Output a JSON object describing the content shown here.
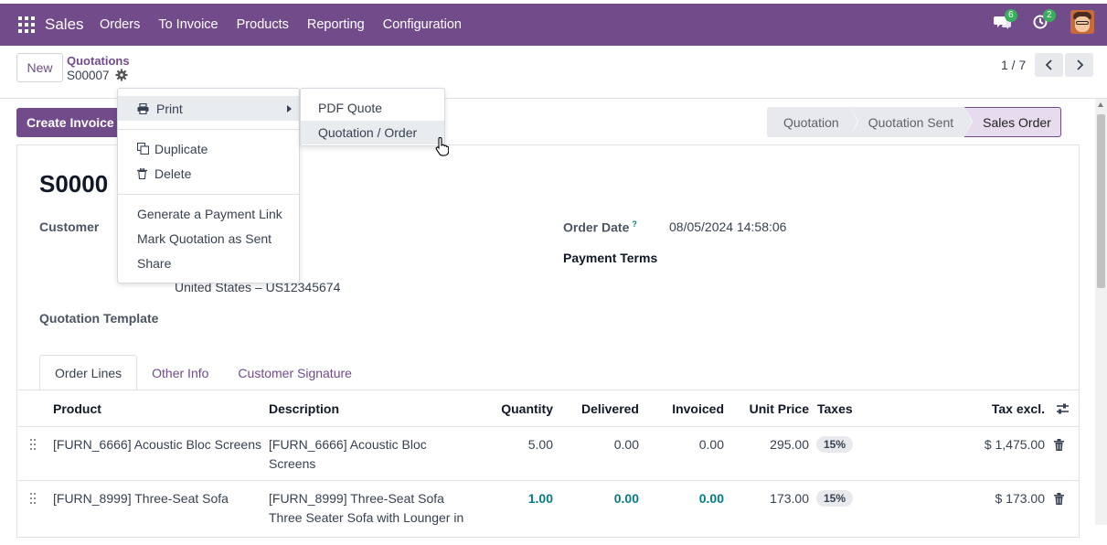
{
  "navbar": {
    "app_name": "Sales",
    "menu": [
      "Orders",
      "To Invoice",
      "Products",
      "Reporting",
      "Configuration"
    ],
    "messages_count": "6",
    "activities_count": "2",
    "brand_color": "#714b8a"
  },
  "control_panel": {
    "new_label": "New",
    "breadcrumb_parent": "Quotations",
    "breadcrumb_current": "S00007",
    "pager_value": "1 / 7"
  },
  "actions": {
    "create_invoice_label": "Create Invoice"
  },
  "statusbar": {
    "stages": [
      "Quotation",
      "Quotation Sent",
      "Sales Order"
    ],
    "current_stage": "Sales Order"
  },
  "form": {
    "order_name": "S0000",
    "customer_label": "Customer",
    "customer_address_line": "United States – US12345674",
    "quotation_template_label": "Quotation Template",
    "order_date_label": "Order Date",
    "order_date_help": "?",
    "order_date_value": "08/05/2024 14:58:06",
    "payment_terms_label": "Payment Terms"
  },
  "tabs": [
    "Order Lines",
    "Other Info",
    "Customer Signature"
  ],
  "table": {
    "headers": {
      "product": "Product",
      "description": "Description",
      "quantity": "Quantity",
      "delivered": "Delivered",
      "invoiced": "Invoiced",
      "unit_price": "Unit Price",
      "taxes": "Taxes",
      "tax_excl": "Tax excl."
    },
    "rows": [
      {
        "product": "[FURN_6666] Acoustic Bloc Screens",
        "description_1": "[FURN_6666] Acoustic Bloc",
        "description_2": "Screens",
        "quantity": "5.00",
        "delivered": "0.00",
        "invoiced": "0.00",
        "unit_price": "295.00",
        "tax": "15%",
        "subtotal": "$ 1,475.00"
      },
      {
        "product": "[FURN_8999] Three-Seat Sofa",
        "description_1": "[FURN_8999] Three-Seat Sofa",
        "description_2": "Three Seater Sofa with Lounger in",
        "quantity": "1.00",
        "delivered": "0.00",
        "invoiced": "0.00",
        "unit_price": "173.00",
        "tax": "15%",
        "subtotal": "$ 173.00"
      }
    ]
  },
  "action_menu": {
    "print_label": "Print",
    "duplicate_label": "Duplicate",
    "delete_label": "Delete",
    "payment_link_label": "Generate a Payment Link",
    "mark_sent_label": "Mark Quotation as Sent",
    "share_label": "Share"
  },
  "print_submenu": {
    "items": [
      "PDF Quote",
      "Quotation / Order"
    ],
    "hovered": "Quotation / Order"
  }
}
